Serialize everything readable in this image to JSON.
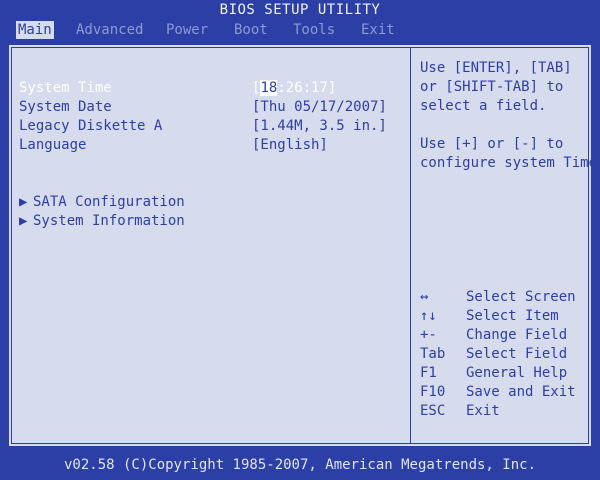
{
  "title": "BIOS SETUP UTILITY",
  "menu": [
    {
      "label": "Main",
      "active": true
    },
    {
      "label": "Advanced",
      "active": false
    },
    {
      "label": "Power",
      "active": false
    },
    {
      "label": "Boot",
      "active": false
    },
    {
      "label": "Tools",
      "active": false
    },
    {
      "label": "Exit",
      "active": false
    }
  ],
  "settings": {
    "system_time": {
      "label": "System Time",
      "value_cursor": "18",
      "value_rest": ":26:17]",
      "value_open": "["
    },
    "system_date": {
      "label": "System Date",
      "value": "[Thu 05/17/2007]"
    },
    "legacy_diskette": {
      "label": "Legacy Diskette A",
      "value": "[1.44M, 3.5 in.]"
    },
    "language": {
      "label": "Language",
      "value": "[English]"
    }
  },
  "submenus": [
    {
      "arrow": "▶",
      "label": "SATA Configuration"
    },
    {
      "arrow": "▶",
      "label": "System Information"
    }
  ],
  "help": {
    "line1": "Use [ENTER], [TAB]",
    "line2": "or [SHIFT-TAB] to",
    "line3": "select a field.",
    "line4": "Use [+] or [-] to",
    "line5": "configure system Time."
  },
  "keys": [
    {
      "key": "↔",
      "desc": "Select Screen"
    },
    {
      "key": "↑↓",
      "desc": "Select Item"
    },
    {
      "key": "+-",
      "desc": "Change Field"
    },
    {
      "key": "Tab",
      "desc": "Select Field"
    },
    {
      "key": "F1",
      "desc": "General Help"
    },
    {
      "key": "F10",
      "desc": "Save and Exit"
    },
    {
      "key": "ESC",
      "desc": "Exit"
    }
  ],
  "footer": "v02.58 (C)Copyright 1985-2007, American Megatrends, Inc.",
  "colors": {
    "background": "#2c3fa6",
    "panel": "#d7dbee",
    "highlight": "#ffffff"
  }
}
